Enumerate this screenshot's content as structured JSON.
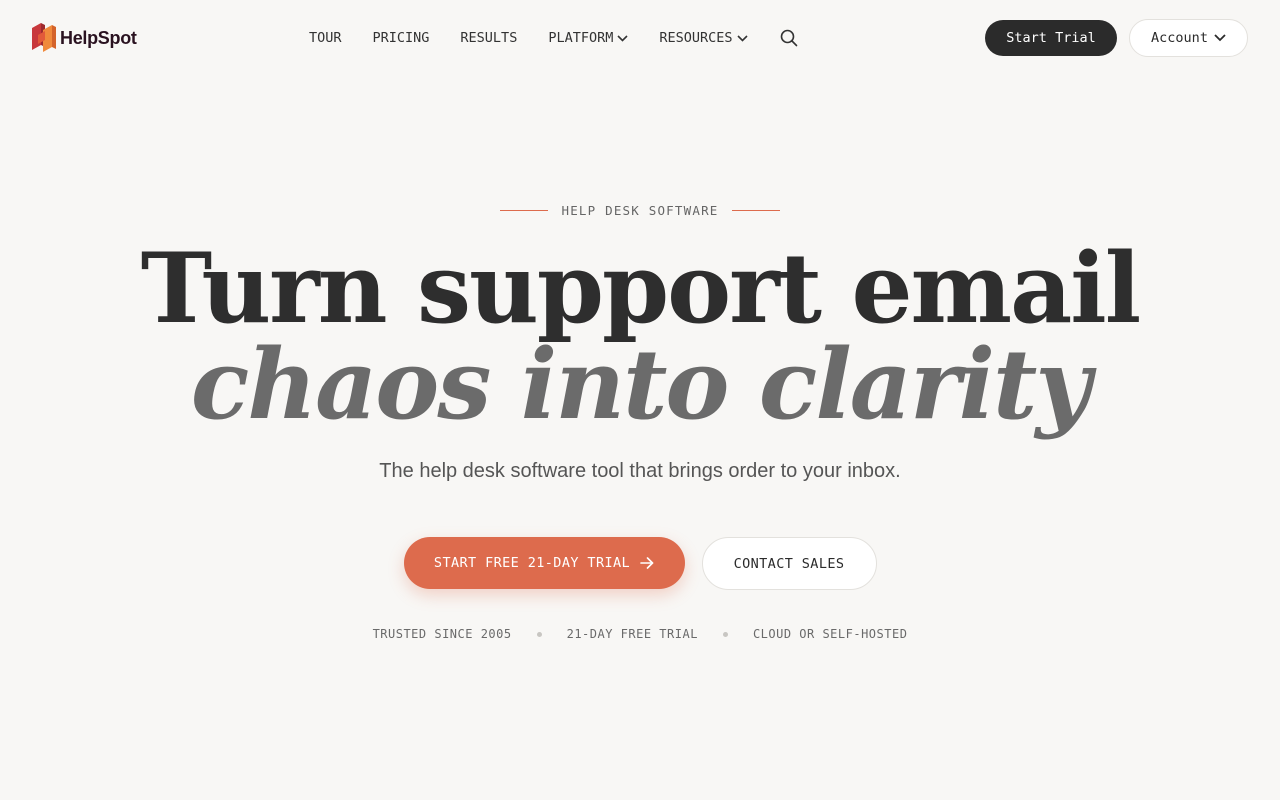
{
  "brand": {
    "name": "HelpSpot",
    "accent_color": "#dd6b4d",
    "dark_color": "#2b2b2b",
    "logo_icon": "helpspot-logo-icon"
  },
  "nav": {
    "items": [
      {
        "label": "TOUR",
        "has_dropdown": false
      },
      {
        "label": "PRICING",
        "has_dropdown": false
      },
      {
        "label": "RESULTS",
        "has_dropdown": false
      },
      {
        "label": "PLATFORM",
        "has_dropdown": true
      },
      {
        "label": "RESOURCES",
        "has_dropdown": true
      }
    ],
    "search_icon": "search-icon"
  },
  "header": {
    "trial_label": "Start Trial",
    "account_label": "Account"
  },
  "hero": {
    "eyebrow": "HELP DESK SOFTWARE",
    "headline_line1": "Turn support email",
    "headline_line2": "chaos into clarity",
    "subhead": "The help desk software tool that brings order to your inbox.",
    "primary_cta": "START FREE 21-DAY TRIAL",
    "primary_cta_icon": "arrow-right-icon",
    "secondary_cta": "CONTACT SALES",
    "trust_items": [
      "TRUSTED SINCE 2005",
      "21-DAY FREE TRIAL",
      "CLOUD OR SELF-HOSTED"
    ]
  }
}
